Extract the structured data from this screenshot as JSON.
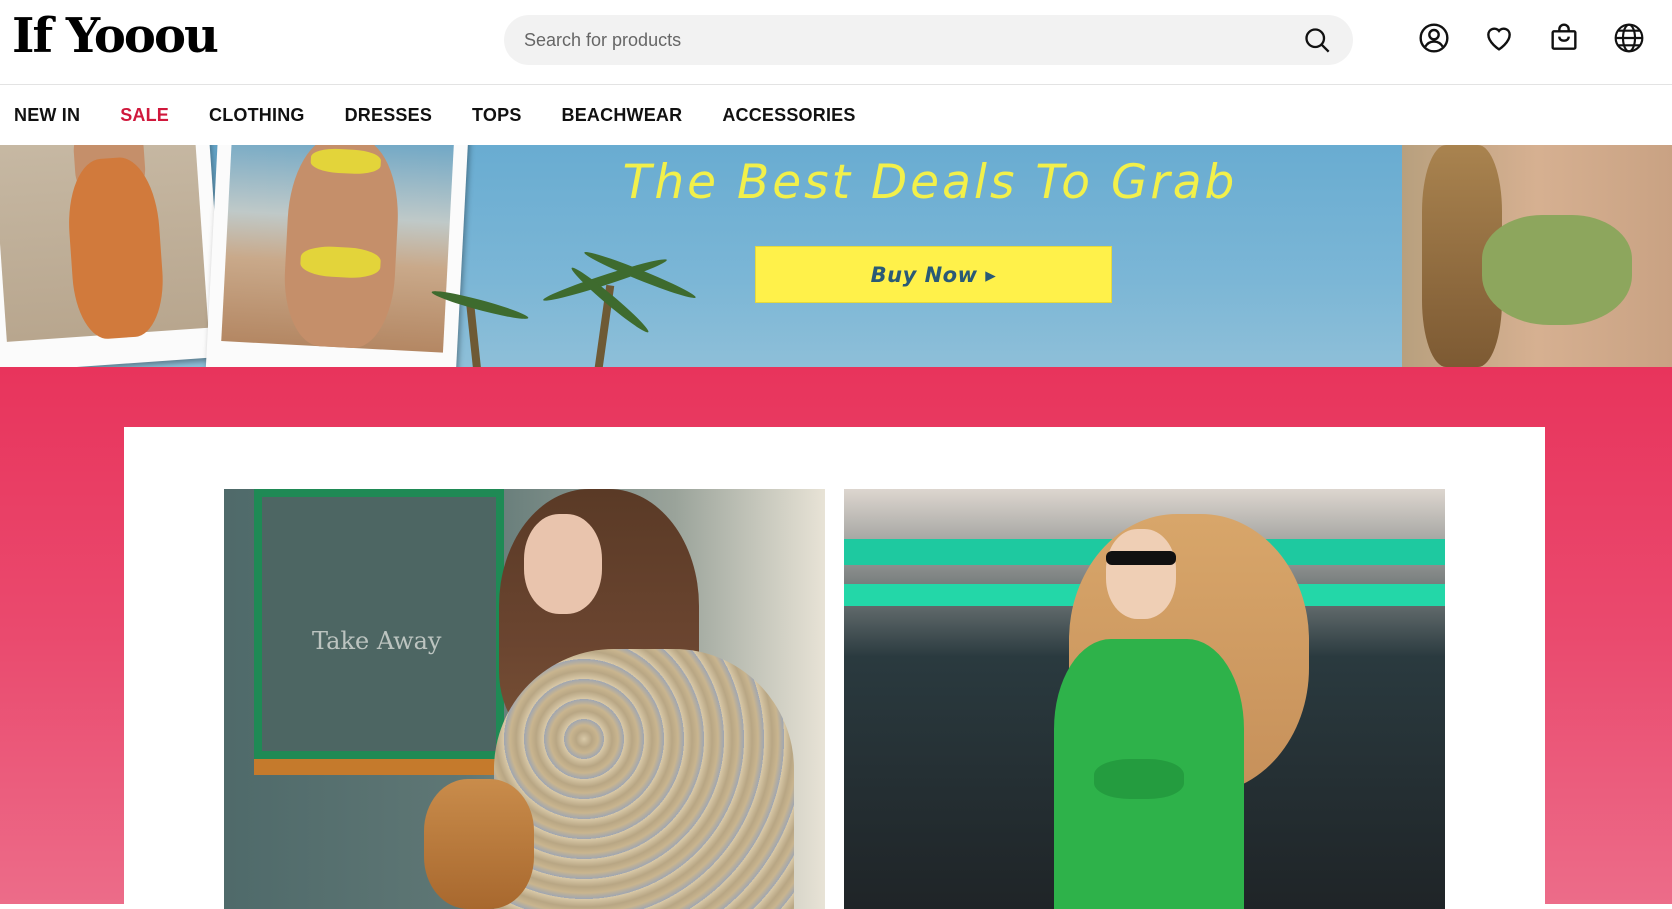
{
  "header": {
    "logo": "If Yooou",
    "search_placeholder": "Search for products",
    "icons": [
      "search-icon",
      "account-icon",
      "wishlist-heart-icon",
      "shopping-bag-icon",
      "globe-language-icon"
    ]
  },
  "nav": {
    "items": [
      {
        "label": "NEW IN"
      },
      {
        "label": "SALE"
      },
      {
        "label": "CLOTHING"
      },
      {
        "label": "DRESSES"
      },
      {
        "label": "TOPS"
      },
      {
        "label": "BEACHWEAR"
      },
      {
        "label": "ACCESSORIES"
      }
    ],
    "sale_color": "#d0183c"
  },
  "banner": {
    "title": "The Best Deals To Grab",
    "button_label": "Buy Now ▸",
    "title_color": "#f2f04a",
    "button_color": "#fff14a"
  },
  "promo": {
    "background_color": "#e8345c",
    "tile_1_sign": "Take Away"
  }
}
